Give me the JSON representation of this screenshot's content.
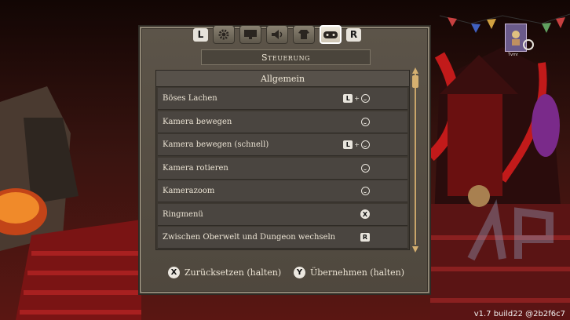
{
  "panel": {
    "title": "Steuerung",
    "tab_left_key": "L",
    "tab_right_key": "R",
    "tabs": [
      {
        "icon": "gear-icon",
        "active": false
      },
      {
        "icon": "monitor-icon",
        "active": false
      },
      {
        "icon": "speaker-icon",
        "active": false
      },
      {
        "icon": "shirt-icon",
        "active": false
      },
      {
        "icon": "gamepad-icon",
        "active": true
      }
    ]
  },
  "list": {
    "header": "Allgemein",
    "rows": [
      {
        "label": "Böses Lachen",
        "binding": [
          "L",
          "+",
          "stick"
        ]
      },
      {
        "label": "Kamera bewegen",
        "binding": [
          "stick"
        ]
      },
      {
        "label": "Kamera bewegen (schnell)",
        "binding": [
          "L",
          "+",
          "stick"
        ]
      },
      {
        "label": "Kamera rotieren",
        "binding": [
          "stick"
        ]
      },
      {
        "label": "Kamerazoom",
        "binding": [
          "stick"
        ]
      },
      {
        "label": "Ringmenü",
        "binding": [
          "X"
        ]
      },
      {
        "label": "Zwischen Oberwelt und Dungeon wechseln",
        "binding": [
          "R"
        ]
      }
    ]
  },
  "footer": {
    "reset_key": "X",
    "reset_label": "Zurücksetzen (halten)",
    "apply_key": "Y",
    "apply_label": "Übernehmen (halten)"
  },
  "hud": {
    "avatar_label": "Tvmr"
  },
  "version": "v1.7 build22 @2b2f6c7",
  "colors": {
    "panel_bg": "#554e44",
    "accent_scroll": "#d6b070",
    "text": "#ece4d4"
  }
}
